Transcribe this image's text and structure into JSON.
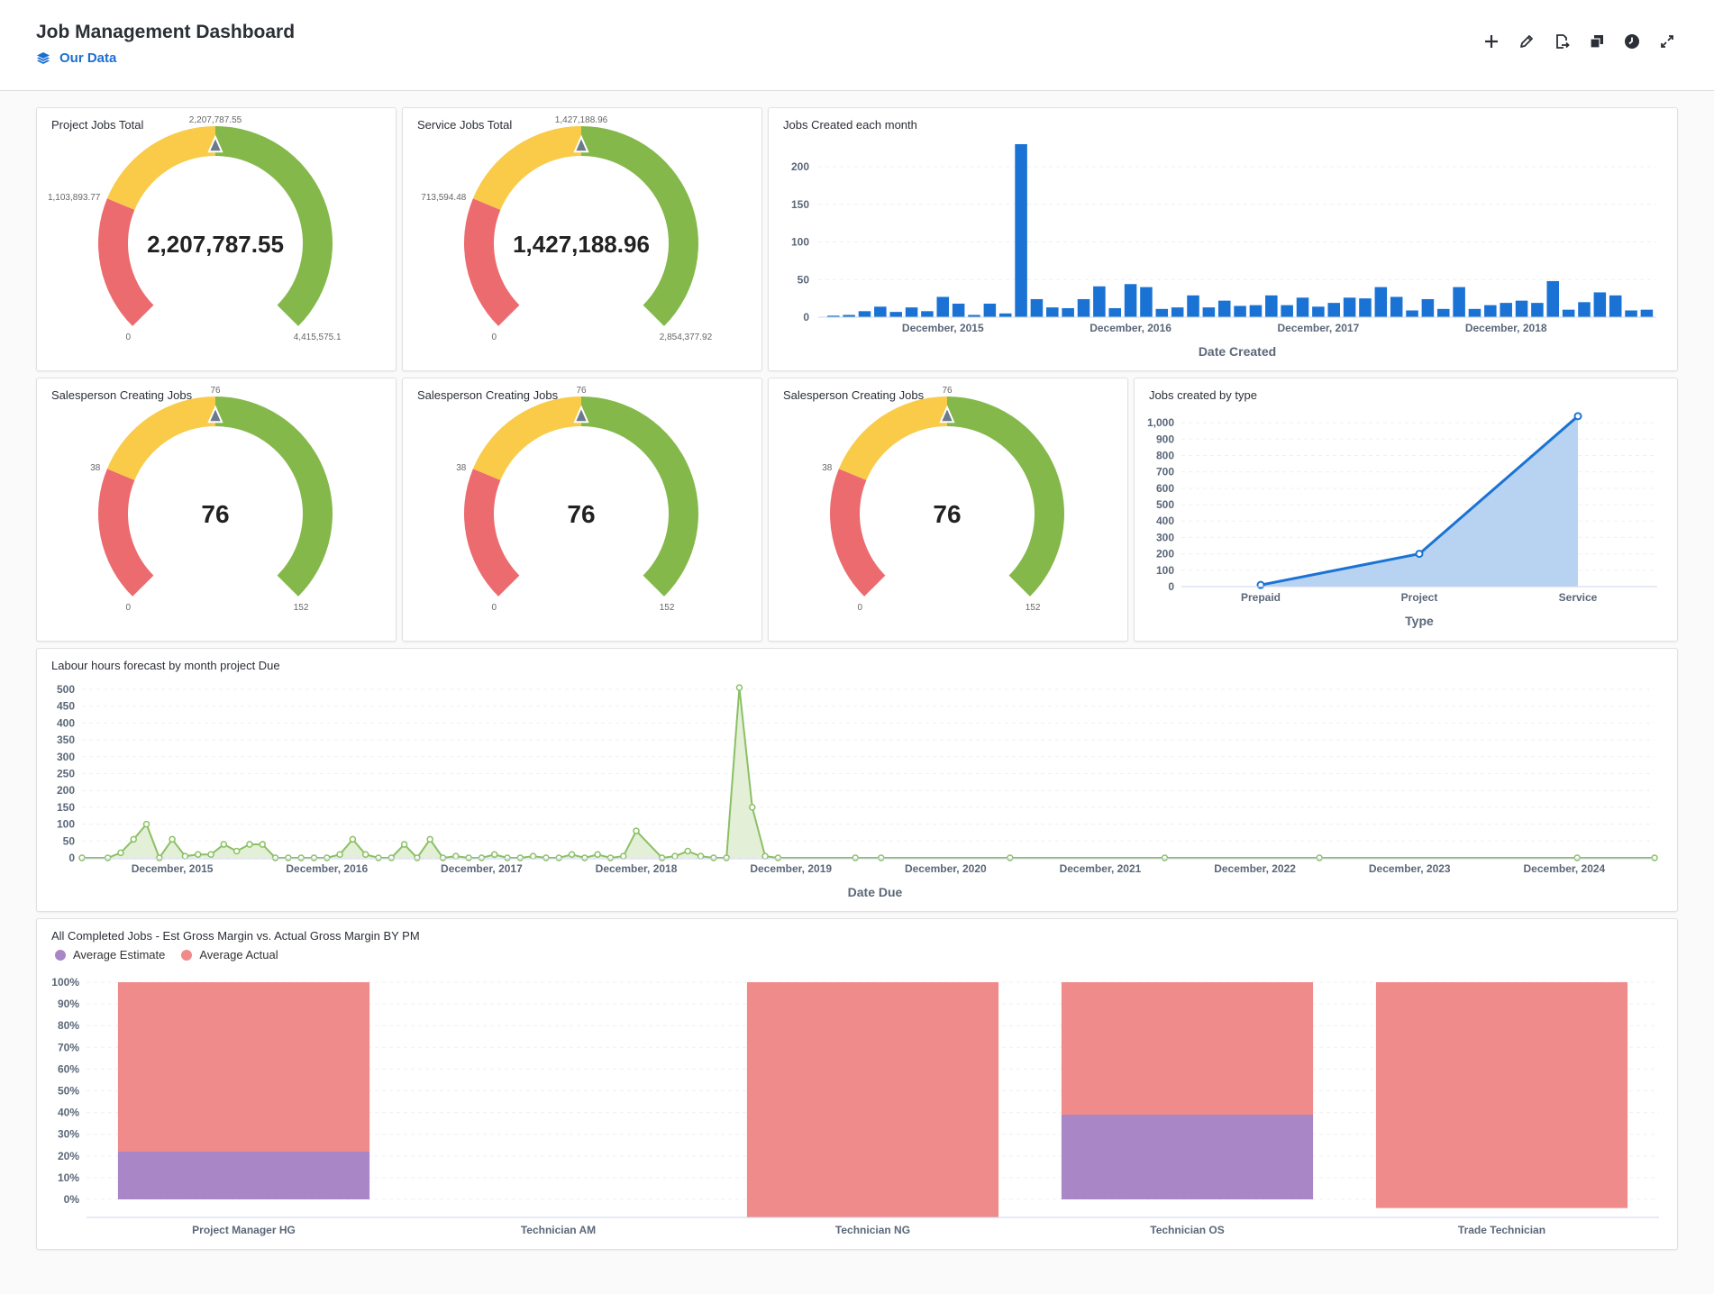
{
  "header": {
    "title": "Job Management Dashboard",
    "subtitle": "Our Data",
    "toolbar": [
      {
        "name": "add",
        "icon": "plus-icon"
      },
      {
        "name": "edit",
        "icon": "pencil-icon"
      },
      {
        "name": "export",
        "icon": "file-export-icon"
      },
      {
        "name": "duplicate",
        "icon": "copy-icon"
      },
      {
        "name": "history",
        "icon": "clock-icon"
      },
      {
        "name": "fullscreen",
        "icon": "expand-icon"
      }
    ]
  },
  "colors": {
    "red": "#ec6b6f",
    "yellow": "#f9cb48",
    "green": "#84b84b",
    "bar_blue": "#1a73d4",
    "line_green": "#8bc064",
    "purple": "#a987c6",
    "pink": "#f08b8c",
    "accent": "#1a6fd1"
  },
  "gauges": [
    {
      "title": "Project Jobs Total",
      "value": 2207787.55,
      "value_label": "2,207,787.55",
      "min_label": "0",
      "mid_label": "1,103,893.77",
      "target_label": "2,207,787.55",
      "max_label": "4,415,575.1",
      "min": 0,
      "max": 4415575.1,
      "bands": [
        0.25,
        0.5,
        1.0
      ]
    },
    {
      "title": "Service Jobs Total",
      "value": 1427188.96,
      "value_label": "1,427,188.96",
      "min_label": "0",
      "mid_label": "713,594.48",
      "target_label": "1,427,188.96",
      "max_label": "2,854,377.92",
      "min": 0,
      "max": 2854377.92,
      "bands": [
        0.25,
        0.5,
        1.0
      ]
    },
    {
      "title": "Salesperson Creating Jobs",
      "value": 76,
      "value_label": "76",
      "min_label": "0",
      "mid_label": "38",
      "target_label": "76",
      "max_label": "152",
      "min": 0,
      "max": 152,
      "bands": [
        0.25,
        0.5,
        1.0
      ]
    },
    {
      "title": "Salesperson Creating Jobs",
      "value": 76,
      "value_label": "76",
      "min_label": "0",
      "mid_label": "38",
      "target_label": "76",
      "max_label": "152",
      "min": 0,
      "max": 152,
      "bands": [
        0.25,
        0.5,
        1.0
      ]
    },
    {
      "title": "Salesperson Creating Jobs",
      "value": 76,
      "value_label": "76",
      "min_label": "0",
      "mid_label": "38",
      "target_label": "76",
      "max_label": "152",
      "min": 0,
      "max": 152,
      "bands": [
        0.25,
        0.5,
        1.0
      ]
    }
  ],
  "chart_data": [
    {
      "id": "jobs-created-monthly",
      "type": "bar",
      "title": "Jobs Created each month",
      "xlabel": "Date Created",
      "ylabel": "",
      "ylim": [
        0,
        230
      ],
      "yticks": [
        0,
        50,
        100,
        150,
        200
      ],
      "xtick_labels": [
        {
          "label": "December, 2015",
          "index": 7
        },
        {
          "label": "December, 2016",
          "index": 19
        },
        {
          "label": "December, 2017",
          "index": 31
        },
        {
          "label": "December, 2018",
          "index": 43
        }
      ],
      "values": [
        2,
        3,
        8,
        14,
        7,
        13,
        8,
        27,
        18,
        3,
        18,
        5,
        230,
        24,
        13,
        12,
        24,
        41,
        12,
        44,
        40,
        11,
        13,
        29,
        13,
        22,
        15,
        16,
        29,
        16,
        26,
        14,
        19,
        26,
        25,
        40,
        27,
        9,
        24,
        11,
        40,
        11,
        16,
        19,
        22,
        19,
        48,
        10,
        20,
        33,
        29,
        9,
        10
      ]
    },
    {
      "id": "jobs-by-type",
      "type": "area",
      "title": "Jobs created by type",
      "xlabel": "Type",
      "ylabel": "",
      "ylim": [
        0,
        1050
      ],
      "yticks": [
        0,
        100,
        200,
        300,
        400,
        500,
        600,
        700,
        800,
        900,
        1000
      ],
      "ytick_labels": [
        "0",
        "100",
        "200",
        "300",
        "400",
        "500",
        "600",
        "700",
        "800",
        "900",
        "1,000"
      ],
      "categories": [
        "Prepaid",
        "Project",
        "Service"
      ],
      "values": [
        10,
        200,
        1040
      ]
    },
    {
      "id": "labour-hours-forecast",
      "type": "area",
      "title": "Labour hours forecast by month project Due",
      "xlabel": "Date Due",
      "ylabel": "",
      "ylim": [
        0,
        500
      ],
      "yticks": [
        0,
        50,
        100,
        150,
        200,
        250,
        300,
        350,
        400,
        450,
        500
      ],
      "xrange_months": [
        0,
        121
      ],
      "xtick_labels": [
        {
          "label": "December, 2015",
          "month": 7
        },
        {
          "label": "December, 2016",
          "month": 19
        },
        {
          "label": "December, 2017",
          "month": 31
        },
        {
          "label": "December, 2018",
          "month": 43
        },
        {
          "label": "December, 2019",
          "month": 55
        },
        {
          "label": "December, 2020",
          "month": 67
        },
        {
          "label": "December, 2021",
          "month": 79
        },
        {
          "label": "December, 2022",
          "month": 91
        },
        {
          "label": "December, 2023",
          "month": 103
        },
        {
          "label": "December, 2024",
          "month": 115
        }
      ],
      "points": [
        [
          0,
          0
        ],
        [
          2,
          0
        ],
        [
          3,
          15
        ],
        [
          4,
          55
        ],
        [
          5,
          100
        ],
        [
          6,
          0
        ],
        [
          7,
          55
        ],
        [
          8,
          5
        ],
        [
          9,
          10
        ],
        [
          10,
          10
        ],
        [
          11,
          40
        ],
        [
          12,
          20
        ],
        [
          13,
          40
        ],
        [
          14,
          40
        ],
        [
          15,
          0
        ],
        [
          16,
          0
        ],
        [
          17,
          0
        ],
        [
          18,
          0
        ],
        [
          19,
          0
        ],
        [
          20,
          10
        ],
        [
          21,
          55
        ],
        [
          22,
          10
        ],
        [
          23,
          0
        ],
        [
          24,
          0
        ],
        [
          25,
          40
        ],
        [
          26,
          0
        ],
        [
          27,
          55
        ],
        [
          28,
          0
        ],
        [
          29,
          5
        ],
        [
          30,
          0
        ],
        [
          31,
          0
        ],
        [
          32,
          10
        ],
        [
          33,
          0
        ],
        [
          34,
          0
        ],
        [
          35,
          5
        ],
        [
          36,
          0
        ],
        [
          37,
          0
        ],
        [
          38,
          10
        ],
        [
          39,
          0
        ],
        [
          40,
          10
        ],
        [
          41,
          0
        ],
        [
          42,
          5
        ],
        [
          43,
          80
        ],
        [
          45,
          0
        ],
        [
          46,
          5
        ],
        [
          47,
          20
        ],
        [
          48,
          5
        ],
        [
          49,
          0
        ],
        [
          50,
          0
        ],
        [
          51,
          505
        ],
        [
          52,
          150
        ],
        [
          53,
          5
        ],
        [
          54,
          0
        ],
        [
          60,
          0
        ],
        [
          62,
          0
        ],
        [
          72,
          0
        ],
        [
          84,
          0
        ],
        [
          96,
          0
        ],
        [
          116,
          0
        ],
        [
          122,
          0
        ]
      ]
    },
    {
      "id": "gross-margin-by-pm",
      "type": "bar",
      "stacked": true,
      "title": "All Completed Jobs - Est Gross Margin vs. Actual Gross Margin BY PM",
      "xlabel": "",
      "ylabel": "",
      "ylim": [
        -0.09,
        1.0
      ],
      "yticks": [
        0,
        0.1,
        0.2,
        0.3,
        0.4,
        0.5,
        0.6,
        0.7,
        0.8,
        0.9,
        1.0
      ],
      "ytick_labels": [
        "0%",
        "10%",
        "20%",
        "30%",
        "40%",
        "50%",
        "60%",
        "70%",
        "80%",
        "90%",
        "100%"
      ],
      "categories": [
        "Project Manager HG",
        "Technician AM",
        "Technician NG",
        "Technician OS",
        "Trade Technician"
      ],
      "series": [
        {
          "name": "Average Estimate",
          "color": "#a987c6",
          "values": [
            0.22,
            0,
            0,
            0.39,
            0
          ]
        },
        {
          "name": "Average Actual",
          "color": "#f08b8c",
          "values": [
            0.78,
            0,
            1.08,
            0.61,
            1.04
          ]
        }
      ],
      "series_ranges": [
        {
          "category": "Project Manager HG",
          "estimate": [
            0,
            0.22
          ],
          "actual": [
            0.22,
            1.0
          ]
        },
        {
          "category": "Technician AM",
          "estimate": null,
          "actual": null
        },
        {
          "category": "Technician NG",
          "estimate": null,
          "actual": [
            -0.09,
            1.0
          ]
        },
        {
          "category": "Technician OS",
          "estimate": [
            0,
            0.39
          ],
          "actual": [
            0.39,
            1.0
          ]
        },
        {
          "category": "Trade Technician",
          "estimate": null,
          "actual": [
            -0.04,
            1.0
          ]
        }
      ]
    }
  ],
  "legend": [
    {
      "label": "Average Estimate",
      "color": "#a987c6"
    },
    {
      "label": "Average Actual",
      "color": "#f08b8c"
    }
  ]
}
